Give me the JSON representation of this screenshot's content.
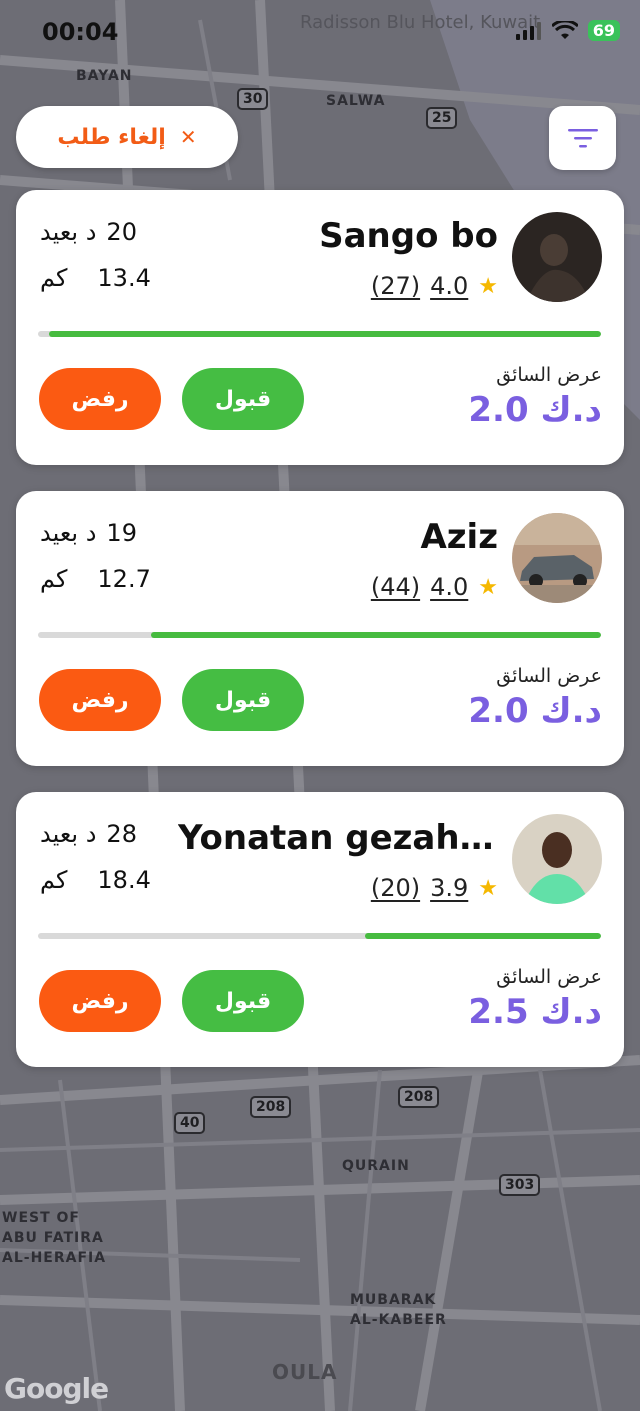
{
  "status_bar": {
    "time": "00:04",
    "battery": "69"
  },
  "map": {
    "labels": [
      "BAYAN",
      "SALWA",
      "QURAIN",
      "WEST OF ABU FATIRA AL-HERAFIA",
      "MUBARAK AL-KABEER",
      "OULA",
      "Radisson Blu Hotel, Kuwait"
    ],
    "road_numbers": [
      "30",
      "25",
      "40",
      "208",
      "208",
      "303"
    ],
    "attribution": "Google"
  },
  "top": {
    "cancel_label": "إلغاء طلب",
    "cancel_icon": "close-icon",
    "filter_icon": "filter-icon"
  },
  "offer_label": "عرض السائق",
  "accept_label": "قبول",
  "reject_label": "رفض",
  "eta_suffix": "د بعيد",
  "distance_unit": "كم",
  "offers": [
    {
      "driver": "Sango bo",
      "rating": "4.0",
      "reviews": "(27)",
      "eta_minutes": "20",
      "distance_km": "13.4",
      "price": "2.0 د.ك",
      "progress": 0.98
    },
    {
      "driver": "Aziz",
      "rating": "4.0",
      "reviews": "(44)",
      "eta_minutes": "19",
      "distance_km": "12.7",
      "price": "2.0 د.ك",
      "progress": 0.8
    },
    {
      "driver": "Yonatan gezah...",
      "rating": "3.9",
      "reviews": "(20)",
      "eta_minutes": "28",
      "distance_km": "18.4",
      "price": "2.5 د.ك",
      "progress": 0.42
    }
  ],
  "colors": {
    "accent": "#7a5fe0",
    "accept": "#45bd43",
    "reject": "#fb5a12",
    "progress": "#46bb3f"
  }
}
